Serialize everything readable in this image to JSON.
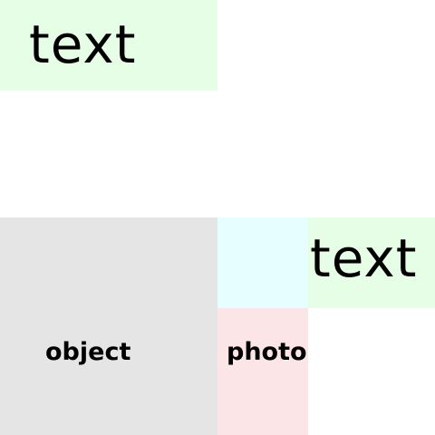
{
  "regions": {
    "text_top_left": {
      "label": "text",
      "color": "#e6fee6"
    },
    "object": {
      "label": "object",
      "color": "#e5e5e5"
    },
    "cyan_block": {
      "label": "",
      "color": "#e6feff"
    },
    "text_right": {
      "label": "text",
      "color": "#e6fee6"
    },
    "photo": {
      "label": "photo",
      "color": "#fbe5e6"
    }
  }
}
